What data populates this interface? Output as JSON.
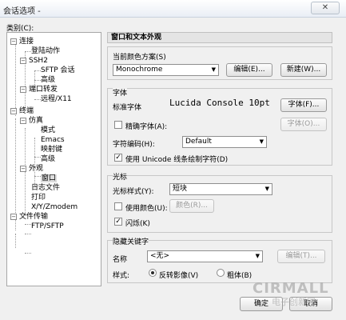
{
  "window": {
    "title": "会话选项 -",
    "close_label": "✕"
  },
  "category_label": "类别(C):",
  "tree": [
    {
      "label": "连接",
      "expander": "−"
    },
    {
      "label": "登陆动作"
    },
    {
      "label": "SSH2",
      "expander": "−"
    },
    {
      "label": "SFTP 会话"
    },
    {
      "label": "高级"
    },
    {
      "label": "端口转发",
      "expander": "−"
    },
    {
      "label": "远程/X11"
    },
    {
      "label": "终端",
      "expander": "−"
    },
    {
      "label": "仿真",
      "expander": "−"
    },
    {
      "label": "模式"
    },
    {
      "label": "Emacs"
    },
    {
      "label": "映射键"
    },
    {
      "label": "高级"
    },
    {
      "label": "外观",
      "expander": "−"
    },
    {
      "label": "窗口"
    },
    {
      "label": "日志文件"
    },
    {
      "label": "打印"
    },
    {
      "label": "X/Y/Zmodem"
    },
    {
      "label": "文件传输",
      "expander": "−"
    },
    {
      "label": "FTP/SFTP"
    }
  ],
  "panel_title": "窗口和文本外观",
  "color_scheme": {
    "label": "当前颜色方案(S)",
    "value": "Monochrome",
    "edit_button": "编辑(E)...",
    "new_button": "新建(W)..."
  },
  "font": {
    "group_title": "字体",
    "standard_label": "标准字体",
    "standard_preview": "Lucida Console 10pt",
    "standard_button": "字体(F)...",
    "precise_label": "精确字体(A):",
    "precise_button": "字体(O)...",
    "encoding_label": "字符编码(H):",
    "encoding_value": "Default",
    "unicode_label": "使用 Unicode 线条绘制字符(D)"
  },
  "cursor": {
    "group_title": "光标",
    "style_label": "光标样式(Y):",
    "style_value": "短块",
    "use_color_label": "使用颜色(U):",
    "color_button": "颜色(R)...",
    "blink_label": "闪烁(K)"
  },
  "hidden_key": {
    "group_title": "隐藏关键字",
    "name_label": "名称",
    "name_value": "<无>",
    "edit_button": "编辑(T)...",
    "style_label": "样式:",
    "reverse_label": "反转影像(V)",
    "bold_label": "粗体(B)"
  },
  "ok_button": "确定",
  "cancel_button": "取消",
  "watermark": "CIRMALL",
  "watermark_sub": "电子创新网"
}
